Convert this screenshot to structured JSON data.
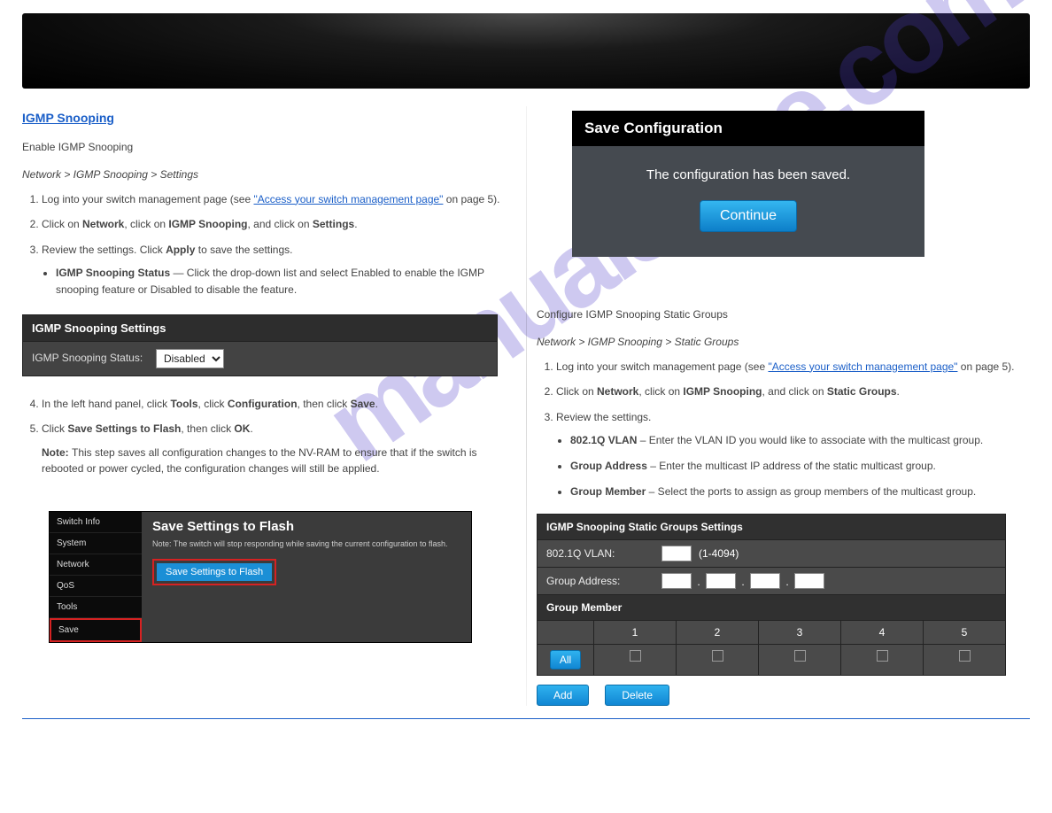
{
  "header": {},
  "left": {
    "section_title": "IGMP Snooping",
    "enable_title": "Enable IGMP Snooping",
    "breadcrumb": "Network > IGMP Snooping > Settings",
    "step1": "Log into your switch management page (see \"Access your switch management page\" on page 5).",
    "step2": "Click on Network, click on IGMP Snooping, and click on Settings.",
    "step3_a": "Review the settings. Click ",
    "step3_b": " to save the settings.",
    "apply_word": "Apply",
    "bullet_label": "IGMP Snooping Status",
    "bullet_text": "— Click the drop-down list and select Enabled to enable the IGMP snooping feature or Disabled to disable the feature.",
    "panel1_title": "IGMP Snooping Settings",
    "panel1_label": "IGMP Snooping Status:",
    "panel1_select": "Disabled",
    "step4_a": "In the left hand panel, click ",
    "step4_b": ", click ",
    "step4_c": ", then click ",
    "step4_d": ".",
    "tools_word": "Tools",
    "config_word": "Configuration",
    "save_word": "Save",
    "step5": "Click Save Settings to Flash, then click OK.",
    "note_label": "Note: ",
    "note_text": "This step saves all configuration changes to the NV-RAM to ensure that if the switch is rebooted or power cycled, the configuration changes will still be applied.",
    "sidebar": [
      "Switch Info",
      "System",
      "Network",
      "QoS",
      "Tools",
      "Save"
    ],
    "flash_title": "Save Settings to Flash",
    "flash_note": "Note: The switch will stop responding while saving the current configuration to flash.",
    "flash_btn": "Save Settings to Flash"
  },
  "right": {
    "saveconf_title": "Save Configuration",
    "saveconf_msg": "The configuration has been saved.",
    "continue_btn": "Continue",
    "section_title": "Configure IGMP Snooping Static Groups",
    "breadcrumb": "Network > IGMP Snooping > Static Groups",
    "step1": "Log into your switch management page (see \"Access your switch management page\" on page 5).",
    "step2_a": "Click on ",
    "step2_b": ", click on ",
    "step2_c": ", and click on ",
    "step2_d": ".",
    "network_word": "Network",
    "igmp_word": "IGMP Snooping",
    "static_groups_word": "Static Groups",
    "step3": "Review the settings.",
    "bullets": {
      "vlan_label": "802.1Q VLAN",
      "vlan_text": " – Enter the VLAN ID you would like to associate with the multicast group.",
      "ga_label": "Group Address",
      "ga_text": " – Enter the multicast IP address of the static multicast group.",
      "gm_label": "Group Member",
      "gm_text": " – Select the ports to assign as group members of the multicast group."
    },
    "panel_title": "IGMP Snooping Static Groups Settings",
    "vlan_label": "802.1Q VLAN:",
    "vlan_range": "(1-4094)",
    "ga_label": "Group Address:",
    "gm_title": "Group Member",
    "ports": [
      "1",
      "2",
      "3",
      "4",
      "5"
    ],
    "all_btn": "All",
    "add_btn": "Add",
    "del_btn": "Delete"
  }
}
